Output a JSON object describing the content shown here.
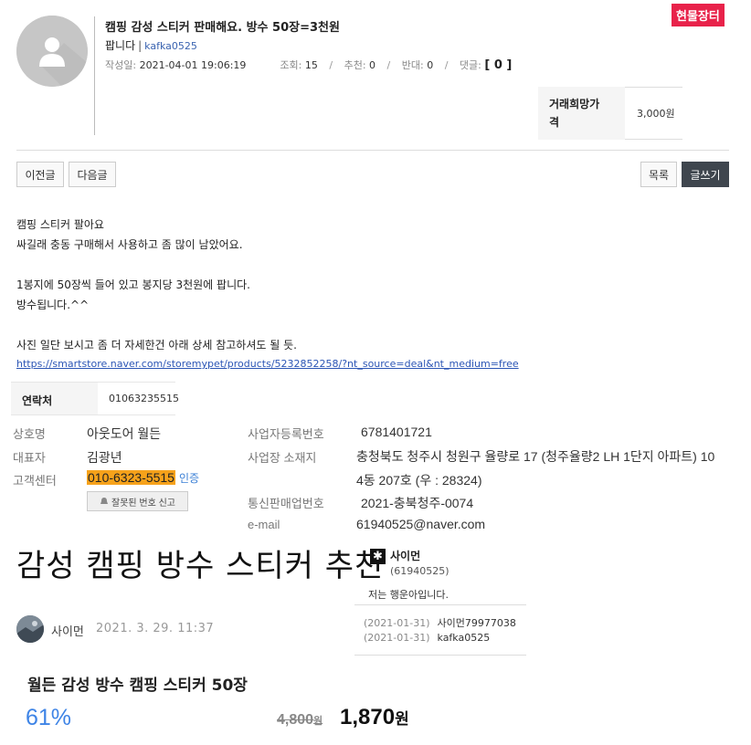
{
  "post": {
    "title": "캠핑 감성 스티커 판매해요. 방수 50장=3천원",
    "badge": "현물장터",
    "type": "팝니다",
    "user_id": "kafka0525",
    "date_label": "작성일:",
    "date": "2021-04-01 19:06:19",
    "views_label": "조회:",
    "views": "15",
    "likes_label": "추천:",
    "likes": "0",
    "dislikes_label": "반대:",
    "dislikes": "0",
    "comments_label": "댓글:",
    "comments": "[ 0 ]",
    "price_label_1": "거래희망가",
    "price_label_2": "격",
    "price": "3,000원"
  },
  "nav": {
    "prev": "이전글",
    "next": "다음글",
    "list": "목록",
    "write": "글쓰기"
  },
  "body": {
    "text": "캠핑 스티커 팔아요\n싸길래 충동 구매해서 사용하고 좀 많이 남았어요.\n\n1봉지에 50장씩 들어 있고 봉지당 3천원에 팝니다.\n방수됩니다.^^\n\n사진 일단 보시고 좀 더 자세한건 아래 상세 참고하셔도 될 듯.",
    "link": "https://smartstore.naver.com/storemypet/products/5232852258/?nt_source=deal&nt_medium=free"
  },
  "contact": {
    "label": "연락처",
    "value": "01063235515"
  },
  "business": {
    "name_label": "상호명",
    "name": "아웃도어 월든",
    "rep_label": "대표자",
    "rep": "김광년",
    "cs_label": "고객센터",
    "cs_phone": "010-6323-5515",
    "verify": "인증",
    "report": "잘못된 번호 신고",
    "reg_label": "사업자등록번호",
    "reg": "6781401721",
    "addr_label": "사업장 소재지",
    "addr_1": "충청북도 청주시 청원구 율량로 17 (청주율량2 LH 1단지 아파트) 10",
    "addr_2": "4동 207호 (우 : 28324)",
    "mail_order_label": "통신판매업번호",
    "mail_order": "2021-충북청주-0074",
    "email_label": "e-mail",
    "email": "61940525@naver.com"
  },
  "blog": {
    "title": "감성 캠핑 방수 스티커 추천",
    "author": "사이먼",
    "date": "2021. 3. 29. 11:37"
  },
  "user_box": {
    "name": "사이먼",
    "id": "(61940525)",
    "message": "저는 행운아입니다.",
    "history": [
      {
        "date": "(2021-01-31)",
        "name": "사이먼79977038"
      },
      {
        "date": "(2021-01-31)",
        "name": "kafka0525"
      }
    ]
  },
  "product": {
    "name": "월든 감성 방수 캠핑 스티커 50장",
    "discount": "61%",
    "original_price": "4,800",
    "original_unit": "원",
    "final_price": "1,870",
    "final_unit": "원"
  },
  "colors": {
    "badge": "#e8224a",
    "link": "#2b55b5",
    "phone_highlight": "#f6a21b",
    "discount": "#3e84e6",
    "write_button": "#3f464e"
  }
}
